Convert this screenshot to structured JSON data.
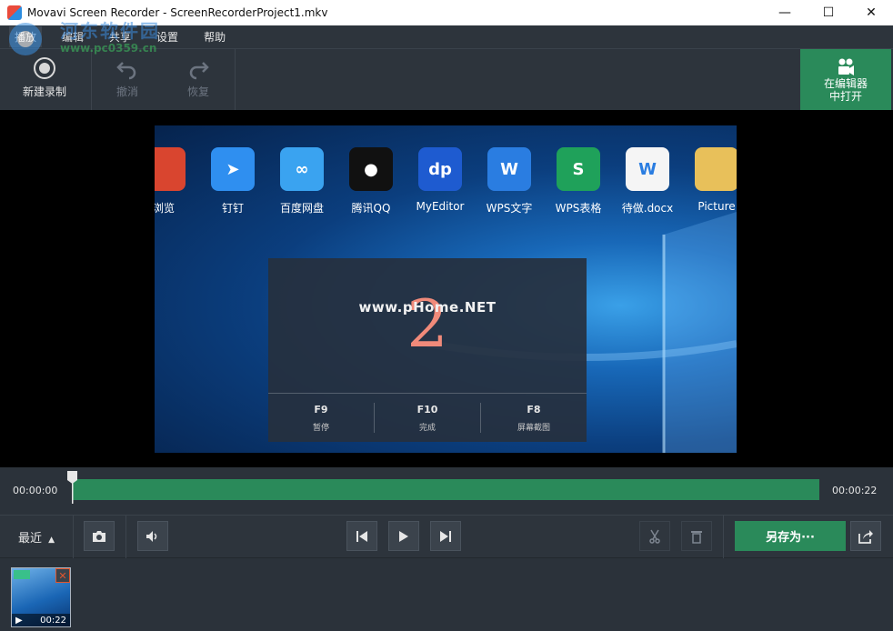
{
  "window": {
    "title": "Movavi Screen Recorder - ScreenRecorderProject1.mkv",
    "minimize_glyph": "—",
    "maximize_glyph": "☐",
    "close_glyph": "✕"
  },
  "menu": {
    "items": [
      {
        "label": "播放"
      },
      {
        "label": "编辑"
      },
      {
        "label": "共享"
      },
      {
        "label": "设置"
      },
      {
        "label": "帮助"
      }
    ]
  },
  "watermark": {
    "site_name": "河东软件园",
    "site_url": "www.pc0359.cn"
  },
  "toolbar": {
    "new_record_label": "新建录制",
    "undo_label": "撤消",
    "redo_label": "恢复",
    "open_editor_line1": "在编辑器",
    "open_editor_line2": "中打开"
  },
  "desktop_icons": [
    {
      "label": "浏览",
      "color": "#d9452f",
      "glyph": ""
    },
    {
      "label": "钉钉",
      "color": "#2f8ff0",
      "glyph": "➤"
    },
    {
      "label": "百度网盘",
      "color": "#3aa3f0",
      "glyph": "∞"
    },
    {
      "label": "腾讯QQ",
      "color": "#111111",
      "glyph": "●"
    },
    {
      "label": "MyEditor",
      "color": "#1e5bd0",
      "glyph": "dp"
    },
    {
      "label": "WPS文字",
      "color": "#2a7de1",
      "glyph": "W"
    },
    {
      "label": "WPS表格",
      "color": "#1fa15a",
      "glyph": "S"
    },
    {
      "label": "待做.docx",
      "color": "#f5f5f5",
      "glyph": "W"
    },
    {
      "label": "Picture",
      "color": "#e8c05a",
      "glyph": ""
    }
  ],
  "countdown": {
    "number": "2",
    "watermark": "www.pHome.NET",
    "keys": [
      {
        "key": "F9",
        "desc": "暂停"
      },
      {
        "key": "F10",
        "desc": "完成"
      },
      {
        "key": "F8",
        "desc": "屏幕截图"
      }
    ]
  },
  "timeline": {
    "start_time": "00:00:00",
    "end_time": "00:00:22",
    "playhead_progress": 0.0
  },
  "controls": {
    "recent_label": "最近",
    "save_as_label": "另存为···"
  },
  "shelf": {
    "thumbnails": [
      {
        "duration": "00:22"
      }
    ]
  },
  "colors": {
    "accent_green": "#2a8a5a",
    "background": "#2b323a"
  }
}
